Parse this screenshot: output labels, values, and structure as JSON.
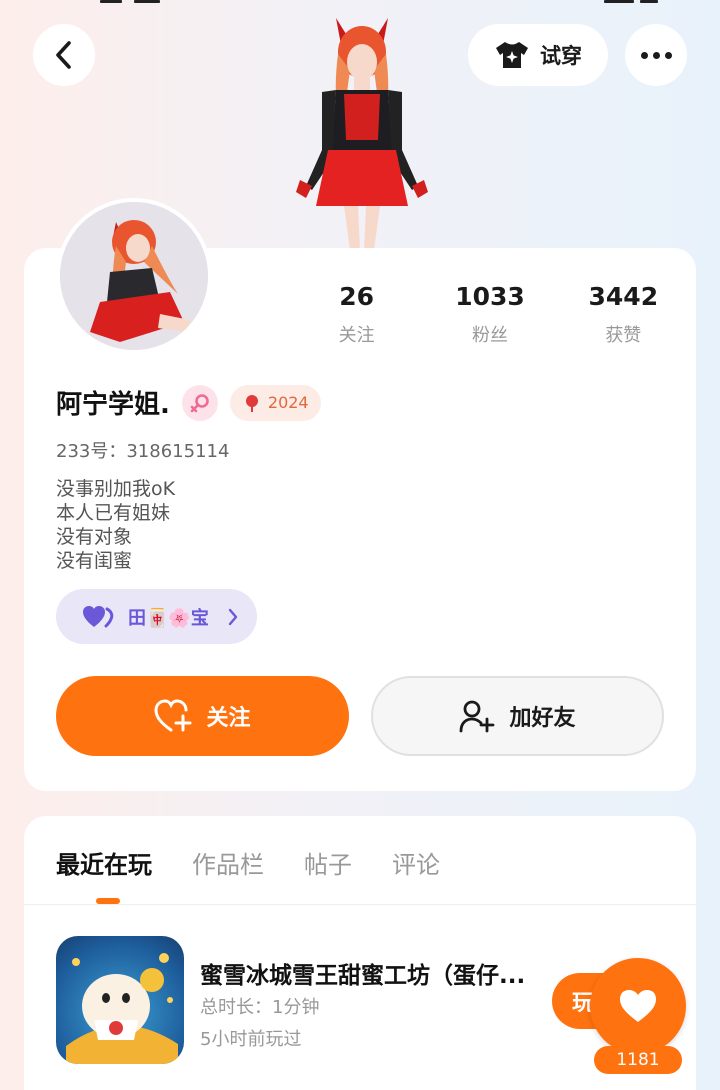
{
  "header": {
    "try_on_label": "试穿"
  },
  "profile": {
    "name": "阿宁学姐.",
    "year_badge": "2024",
    "uid": "233号：318615114",
    "bio": [
      "没事别加我oK",
      "本人已有姐妹",
      "没有对象",
      "没有闺蜜"
    ],
    "fan_badge_label": "田🀄🌸宝",
    "stats": [
      {
        "value": "26",
        "label": "关注"
      },
      {
        "value": "1033",
        "label": "粉丝"
      },
      {
        "value": "3442",
        "label": "获赞"
      }
    ],
    "follow_label": "关注",
    "add_friend_label": "加好友"
  },
  "tabs": [
    {
      "label": "最近在玩",
      "active": true
    },
    {
      "label": "作品栏",
      "active": false
    },
    {
      "label": "帖子",
      "active": false
    },
    {
      "label": "评论",
      "active": false
    }
  ],
  "recent_games": [
    {
      "title": "蜜雪冰城雪王甜蜜工坊（蛋仔...",
      "duration": "总时长：1分钟",
      "last_played": "5小时前玩过",
      "play_label": "玩"
    }
  ],
  "like_fab": {
    "count": "1181"
  },
  "colors": {
    "accent": "#ff7210",
    "fan_purple": "#6a58d8",
    "gender_pink": "#f06a96"
  }
}
